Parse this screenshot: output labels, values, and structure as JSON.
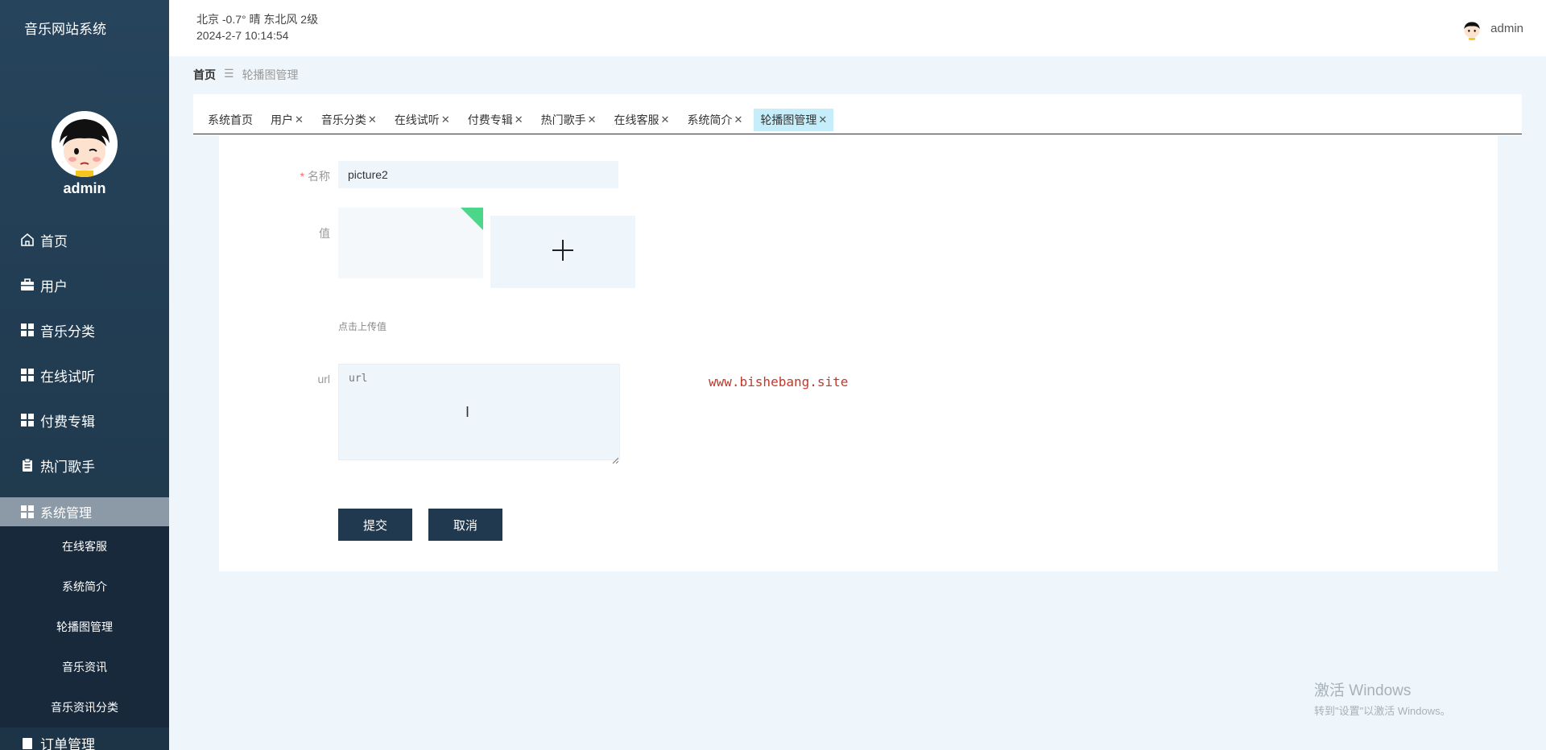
{
  "app": {
    "title": "音乐网站系统"
  },
  "sidebar": {
    "username": "admin",
    "menu": [
      {
        "label": "首页",
        "icon": "home-icon"
      },
      {
        "label": "用户",
        "icon": "briefcase-icon"
      },
      {
        "label": "音乐分类",
        "icon": "grid-icon"
      },
      {
        "label": "在线试听",
        "icon": "grid-icon"
      },
      {
        "label": "付费专辑",
        "icon": "grid-icon"
      },
      {
        "label": "热门歌手",
        "icon": "clipboard-icon"
      }
    ],
    "active_menu": {
      "label": "系统管理",
      "icon": "grid-icon"
    },
    "submenu": [
      "在线客服",
      "系统简介",
      "轮播图管理",
      "音乐资讯",
      "音乐资讯分类"
    ],
    "next_menu_partial": "订单管理"
  },
  "header": {
    "weather_line": "北京  -0.7°  晴  东北风  2级",
    "datetime": "2024-2-7 10:14:54",
    "username": "admin"
  },
  "breadcrumb": {
    "home": "首页",
    "separator": "☰",
    "current": "轮播图管理"
  },
  "tabs": [
    {
      "label": "系统首页",
      "closable": false
    },
    {
      "label": "用户",
      "closable": true
    },
    {
      "label": "音乐分类",
      "closable": true
    },
    {
      "label": "在线试听",
      "closable": true
    },
    {
      "label": "付费专辑",
      "closable": true
    },
    {
      "label": "热门歌手",
      "closable": true
    },
    {
      "label": "在线客服",
      "closable": true
    },
    {
      "label": "系统简介",
      "closable": true
    },
    {
      "label": "轮播图管理",
      "closable": true,
      "active": true
    }
  ],
  "form": {
    "name_label": "名称",
    "name_required_mark": "*",
    "name_value": "picture2",
    "value_label": "值",
    "upload_hint": "点击上传值",
    "url_label": "url",
    "url_placeholder": "url",
    "submit_label": "提交",
    "cancel_label": "取消"
  },
  "watermark": "www.bishebang.site",
  "windows_activation": {
    "line1": "激活 Windows",
    "line2": "转到\"设置\"以激活 Windows。"
  },
  "colors": {
    "sidebar": "#26445c",
    "active_tab": "#c6eefa",
    "button": "#21394f",
    "accent_corner": "#4cd68a"
  }
}
